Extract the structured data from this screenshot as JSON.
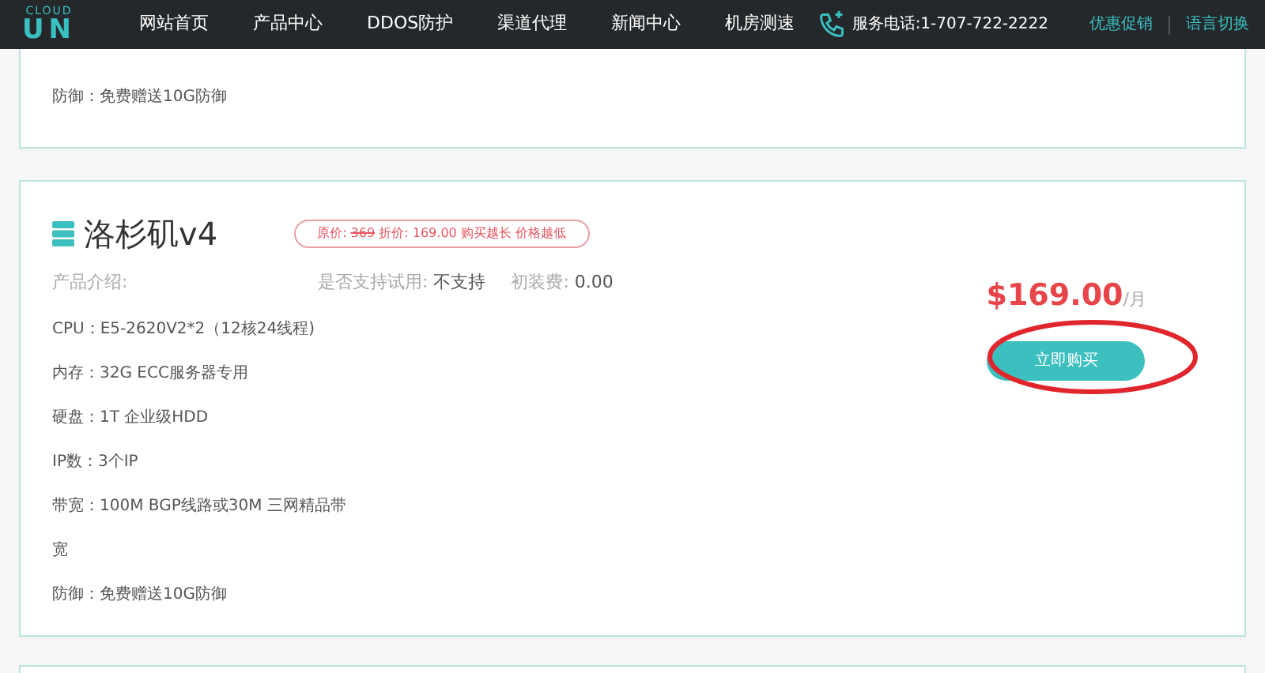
{
  "navbar": {
    "logo_text": "CLOUD",
    "logo_mark": "UN",
    "links": [
      {
        "label": "网站首页",
        "selected": false
      },
      {
        "label": "产品中心",
        "selected": false
      },
      {
        "label": "DDOS防护",
        "selected": false
      },
      {
        "label": "渠道代理",
        "selected": false
      },
      {
        "label": "新闻中心",
        "selected": false
      },
      {
        "label": "机房测速",
        "selected": false
      }
    ],
    "phone": "服务电话:1-707-722-2222",
    "promo": "优惠促销",
    "language": "语言切换"
  },
  "previous_card": {
    "lines": [
      "防御：免费赠送10G防御"
    ]
  },
  "product": {
    "title": "洛杉矶v4",
    "price_badge": {
      "original_label": "原价:",
      "original_price": "369",
      "rest": "折价: 169.00 购买越长 价格越低"
    },
    "intro_label": "产品介绍:",
    "trial_label": "是否支持试用:",
    "trial_value": "不支持",
    "setup_label": "初装费:",
    "setup_value": "0.00",
    "specs": [
      "CPU：E5-2620V2*2（12核24线程)",
      "内存：32G ECC服务器专用",
      "硬盘：1T 企业级HDD",
      "IP数：3个IP",
      "带宽：100M BGP线路或30M 三网精品带",
      "宽",
      "防御：免费赠送10G防御"
    ],
    "price": "$169.00",
    "price_unit": "/月",
    "buy_button": "立即购买",
    "highlighted": true
  }
}
